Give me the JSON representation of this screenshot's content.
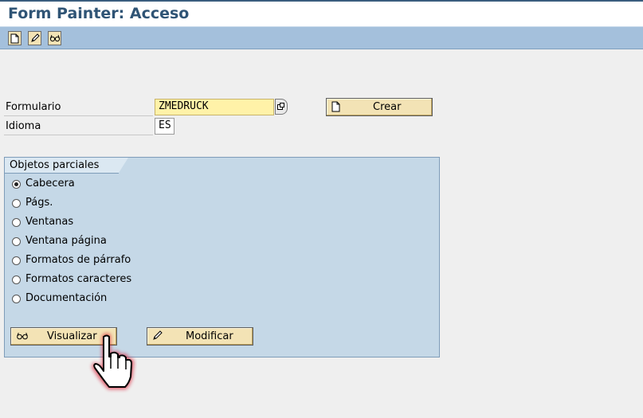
{
  "window": {
    "title": "Form Painter: Acceso"
  },
  "toolbar": {
    "buttons": [
      {
        "icon": "new-document-icon"
      },
      {
        "icon": "pencil-icon"
      },
      {
        "icon": "glasses-icon"
      }
    ]
  },
  "form": {
    "formulario_label": "Formulario",
    "formulario_value": "ZMEDRUCK",
    "idioma_label": "Idioma",
    "idioma_value": "ES",
    "crear_label": "Crear"
  },
  "group": {
    "title": "Objetos parciales",
    "options": [
      {
        "label": "Cabecera",
        "selected": true
      },
      {
        "label": "Págs.",
        "selected": false
      },
      {
        "label": "Ventanas",
        "selected": false
      },
      {
        "label": "Ventana página",
        "selected": false
      },
      {
        "label": "Formatos de párrafo",
        "selected": false
      },
      {
        "label": "Formatos caracteres",
        "selected": false
      },
      {
        "label": "Documentación",
        "selected": false
      }
    ],
    "visualizar_label": "Visualizar",
    "modificar_label": "Modificar"
  },
  "colors": {
    "title": "#2f5475",
    "toolbar": "#a4c0dc",
    "required_field": "#fff2a8",
    "button": "#f3e3b5",
    "groupbox": "#c5d8e7",
    "cursor_glow": "#d9142b"
  }
}
